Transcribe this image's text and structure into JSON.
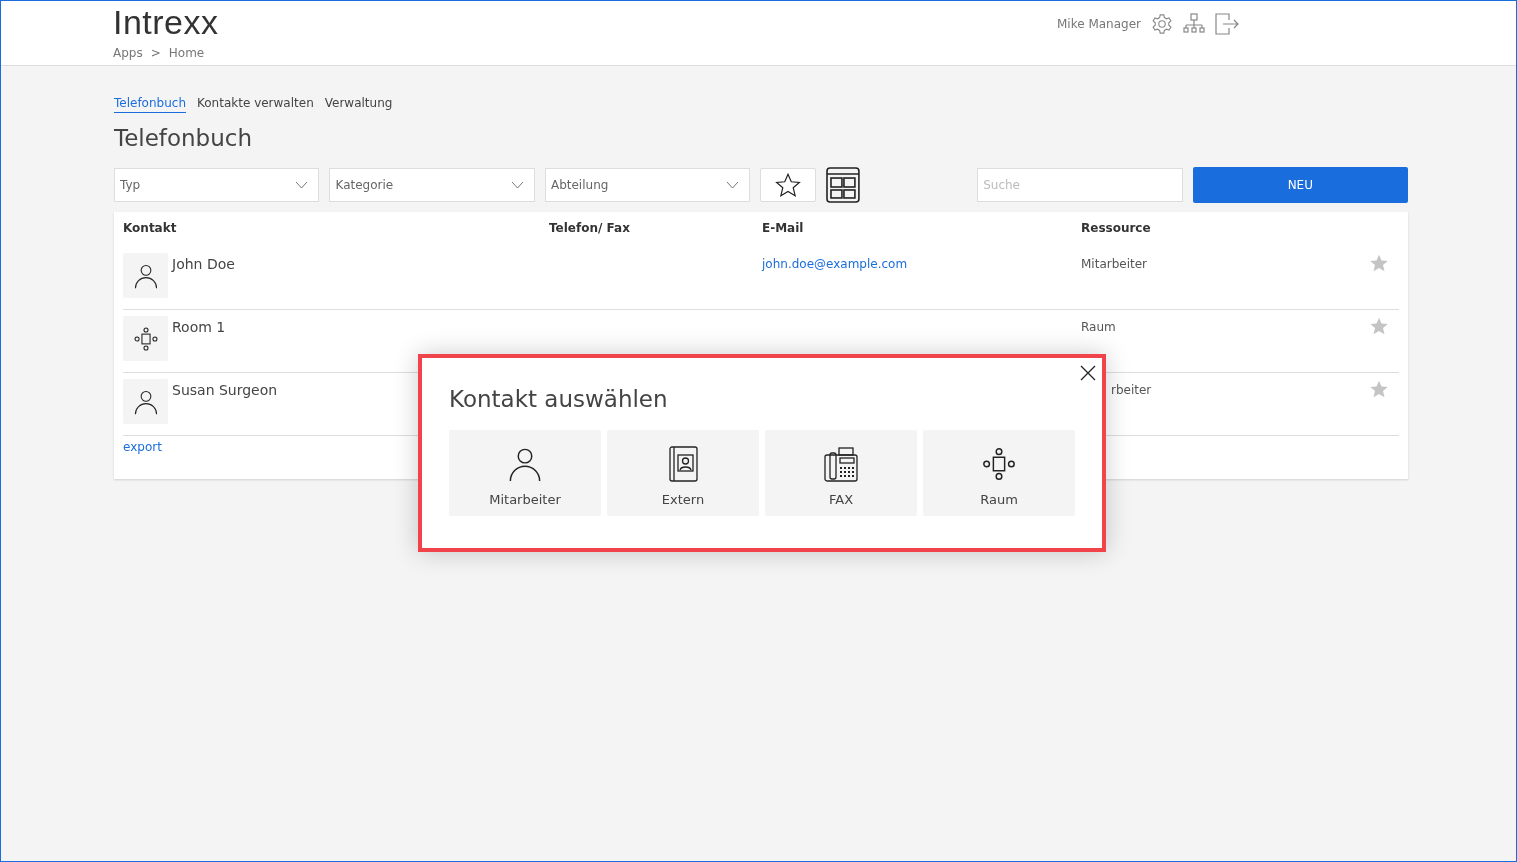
{
  "header": {
    "logo": "Intrexx",
    "breadcrumbs": [
      "Apps",
      "Home"
    ],
    "separator": ">",
    "user": "Mike Manager"
  },
  "tabs": [
    {
      "label": "Telefonbuch",
      "selected": true
    },
    {
      "label": "Kontakte verwalten",
      "selected": false
    },
    {
      "label": "Verwaltung",
      "selected": false
    }
  ],
  "page_title": "Telefonbuch",
  "filters": [
    {
      "placeholder": "Typ"
    },
    {
      "placeholder": "Kategorie"
    },
    {
      "placeholder": "Abteilung"
    }
  ],
  "search": {
    "placeholder": "Suche"
  },
  "new_button": "NEU",
  "table": {
    "columns": [
      "Kontakt",
      "Telefon/ Fax",
      "E-Mail",
      "Ressource"
    ],
    "rows": [
      {
        "kind": "person",
        "name": "John Doe",
        "email": "john.doe@example.com",
        "resource": "Mitarbeiter",
        "favorite": false
      },
      {
        "kind": "room",
        "name": "Room 1",
        "resource": "Raum",
        "favorite": false
      },
      {
        "kind": "person",
        "name": "Susan Surgeon",
        "resource": "rbeiter",
        "resource_partly_hidden": true,
        "favorite": false
      }
    ],
    "export_link": "export"
  },
  "dialog": {
    "title": "Kontakt auswählen",
    "options": [
      {
        "kind": "person",
        "label": "Mitarbeiter"
      },
      {
        "kind": "contact_book",
        "label": "Extern"
      },
      {
        "kind": "fax",
        "label": "FAX"
      },
      {
        "kind": "room",
        "label": "Raum"
      }
    ]
  }
}
